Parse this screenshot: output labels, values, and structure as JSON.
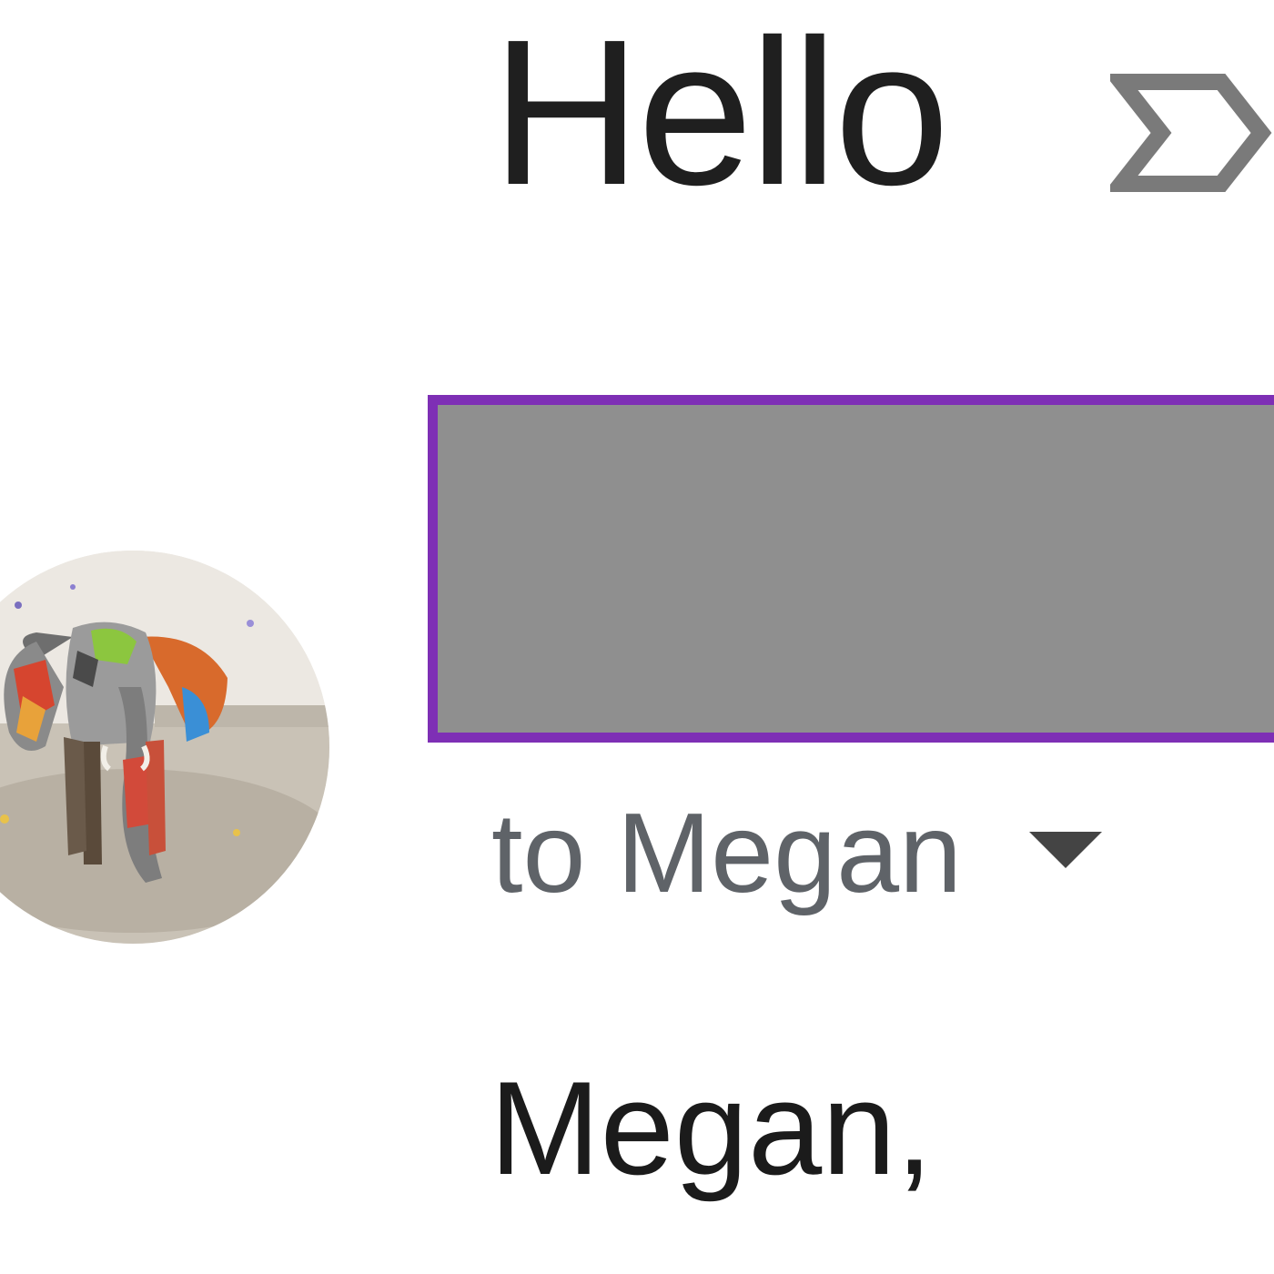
{
  "message": {
    "subject": "Hello",
    "recipient_line": "to Megan",
    "body_greeting": "Megan,"
  },
  "icons": {
    "importance": "important-marker-icon",
    "recipient_toggle": "chevron-down-icon",
    "avatar": "elephant-avatar"
  },
  "colors": {
    "redaction_fill": "#8f8f8f",
    "redaction_border": "#7e2fb5",
    "subject_text": "#1f1f1f",
    "secondary_text": "#5f6368"
  }
}
